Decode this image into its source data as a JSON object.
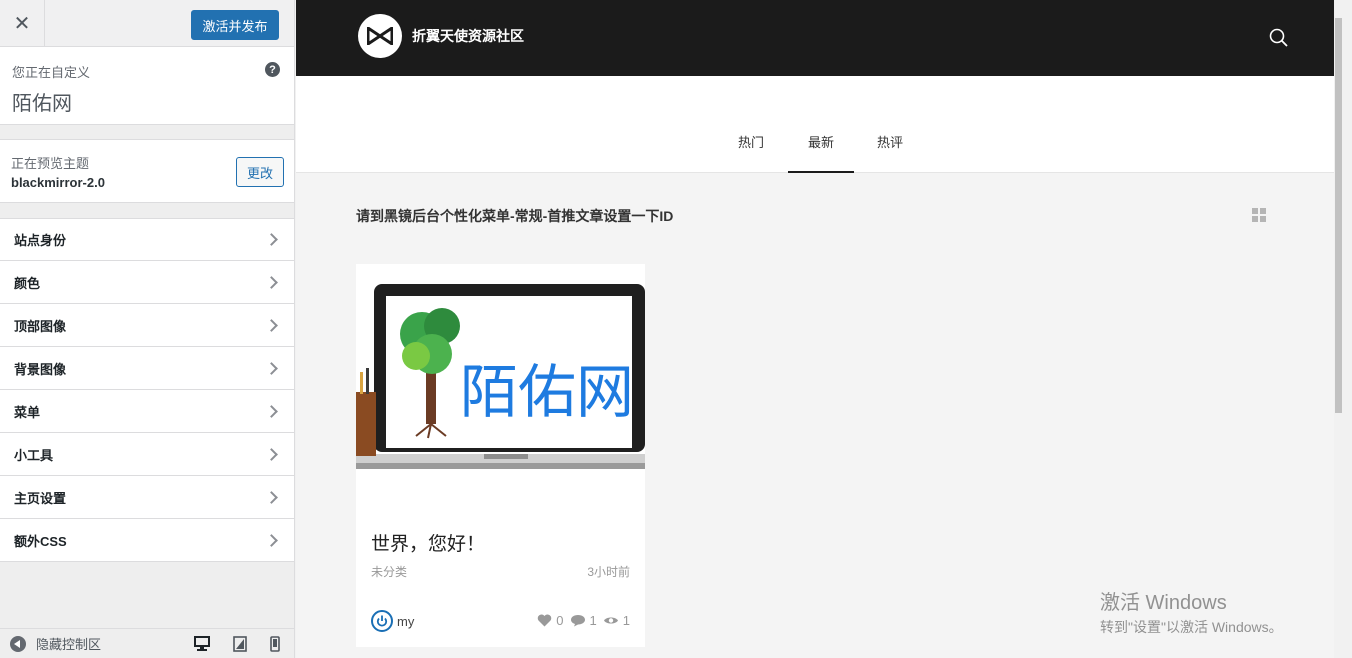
{
  "customizer": {
    "close_label": "✕",
    "publish_label": "激活并发布",
    "info_prefix": "您正在自定义",
    "site_name": "陌佑网",
    "help_label": "?",
    "theme_label": "正在预览主题",
    "theme_name": "blackmirror-2.0",
    "change_label": "更改",
    "panels": [
      {
        "label": "站点身份"
      },
      {
        "label": "颜色"
      },
      {
        "label": "顶部图像"
      },
      {
        "label": "背景图像"
      },
      {
        "label": "菜单"
      },
      {
        "label": "小工具"
      },
      {
        "label": "主页设置"
      },
      {
        "label": "额外CSS"
      }
    ],
    "collapse_label": "隐藏控制区"
  },
  "preview": {
    "site_title": "折翼天使资源社区",
    "tabs": {
      "hot": "热门",
      "latest": "最新",
      "comments": "热评"
    },
    "active_tab": "latest",
    "section_title": "请到黑镜后台个性化菜单-常规-首推文章设置一下ID",
    "post": {
      "thumb_text": "陌佑网",
      "title": "世界，您好！",
      "category": "未分类",
      "time": "3小时前",
      "author": "my",
      "likes": "0",
      "comments": "1",
      "views": "1"
    }
  },
  "watermark": {
    "title": "激活 Windows",
    "subtitle": "转到\"设置\"以激活 Windows。"
  },
  "colors": {
    "accent": "#2271b1",
    "header_bg": "#1b1b1b",
    "thumb_text": "#1e7be0"
  }
}
